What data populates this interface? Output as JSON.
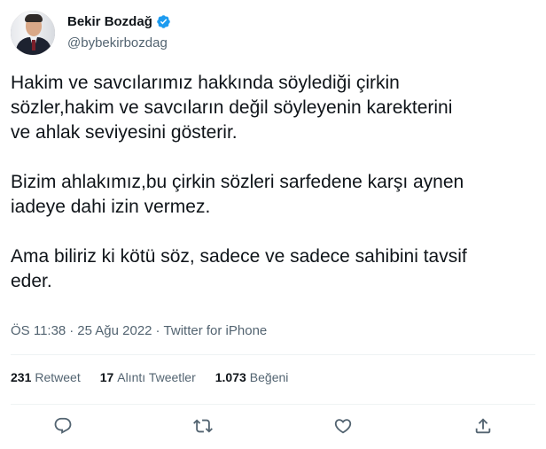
{
  "author": {
    "name": "Bekir Bozdağ",
    "handle": "@bybekirbozdag",
    "verified": true
  },
  "tweet": {
    "paragraphs": [
      "Hakim ve savcılarımız hakkında söylediği çirkin\nsözler,hakim ve savcıların değil söyleyenin karekterini\nve ahlak seviyesini gösterir.",
      "Bizim ahlakımız,bu çirkin sözleri sarfedene karşı aynen\niadeye dahi izin vermez.",
      "Ama biliriz ki kötü söz, sadece ve sadece sahibini tavsif\neder."
    ]
  },
  "meta": {
    "time": "ÖS 11:38",
    "separator1": "·",
    "date": "25 Ağu 2022",
    "separator2": "·",
    "source": "Twitter for iPhone"
  },
  "stats": {
    "retweets": {
      "count": "231",
      "label": "Retweet"
    },
    "quotes": {
      "count": "17",
      "label": "Alıntı Tweetler"
    },
    "likes": {
      "count": "1.073",
      "label": "Beğeni"
    }
  },
  "actions": [
    "reply-icon",
    "retweet-icon",
    "like-icon",
    "share-icon"
  ],
  "colors": {
    "text": "#0f1419",
    "secondary": "#536471",
    "verified": "#1d9bf0",
    "divider": "#eff3f4"
  }
}
